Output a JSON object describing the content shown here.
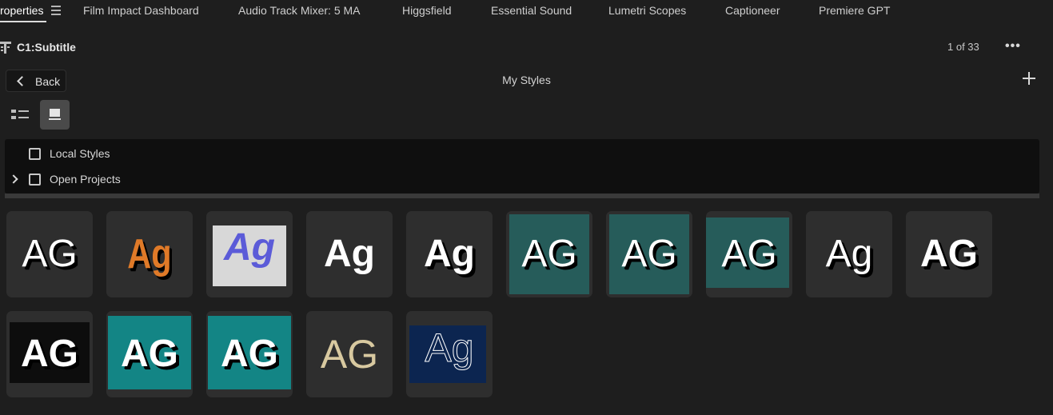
{
  "tabs": [
    {
      "label": "roperties",
      "active": true
    },
    {
      "label": "Film Impact Dashboard"
    },
    {
      "label": "Audio Track Mixer: 5 MA"
    },
    {
      "label": "Higgsfield"
    },
    {
      "label": "Essential Sound"
    },
    {
      "label": "Lumetri Scopes"
    },
    {
      "label": "Captioneer"
    },
    {
      "label": "Premiere GPT"
    }
  ],
  "clip": {
    "title": "C1:Subtitle",
    "page_count": "1 of 33",
    "more_label": "•••"
  },
  "nav": {
    "back_label": "Back",
    "section_title": "My Styles"
  },
  "view_mode": "grid",
  "sources": [
    {
      "label": "Local Styles",
      "checked": false,
      "expandable": false
    },
    {
      "label": "Open Projects",
      "checked": false,
      "expandable": true
    }
  ],
  "styles": [
    {
      "text": "AG",
      "bg": "#2e2e2e",
      "fg": "#ffffff",
      "shadow": "#000000"
    },
    {
      "text": "Ag",
      "bg": "#2e2e2e",
      "fg": "#e07a28",
      "shadow": "#000000"
    },
    {
      "text": "Ag",
      "bg": "#d8d8d8",
      "fg": "#5b5bd8",
      "shadow": "none"
    },
    {
      "text": "Ag",
      "bg": "#2e2e2e",
      "fg": "#ffffff",
      "shadow": "none"
    },
    {
      "text": "Ag",
      "bg": "#2e2e2e",
      "fg": "#ffffff",
      "shadow": "#000000"
    },
    {
      "text": "AG",
      "bg": "#265c5a",
      "fg": "#ffffff",
      "shadow": "#000000"
    },
    {
      "text": "AG",
      "bg": "#265c5a",
      "fg": "#ffffff",
      "shadow": "#000000"
    },
    {
      "text": "AG",
      "bg": "#265c5a",
      "fg": "#ffffff",
      "shadow": "#000000"
    },
    {
      "text": "Ag",
      "bg": "#2e2e2e",
      "fg": "#ffffff",
      "shadow": "#000000"
    },
    {
      "text": "AG",
      "bg": "#2e2e2e",
      "fg": "#ffffff",
      "shadow": "#000000"
    },
    {
      "text": "AG",
      "bg": "#0d0d0d",
      "fg": "#ffffff",
      "shadow": "#000000"
    },
    {
      "text": "AG",
      "bg": "#138585",
      "fg": "#ffffff",
      "shadow": "#000000"
    },
    {
      "text": "AG",
      "bg": "#138585",
      "fg": "#ffffff",
      "shadow": "#000000"
    },
    {
      "text": "AG",
      "bg": "#2e2e2e",
      "fg": "#d8c9a0",
      "shadow": "none"
    },
    {
      "text": "Ag",
      "bg": "#0c2550",
      "fg": "#ffffff",
      "shadow": "none"
    }
  ]
}
